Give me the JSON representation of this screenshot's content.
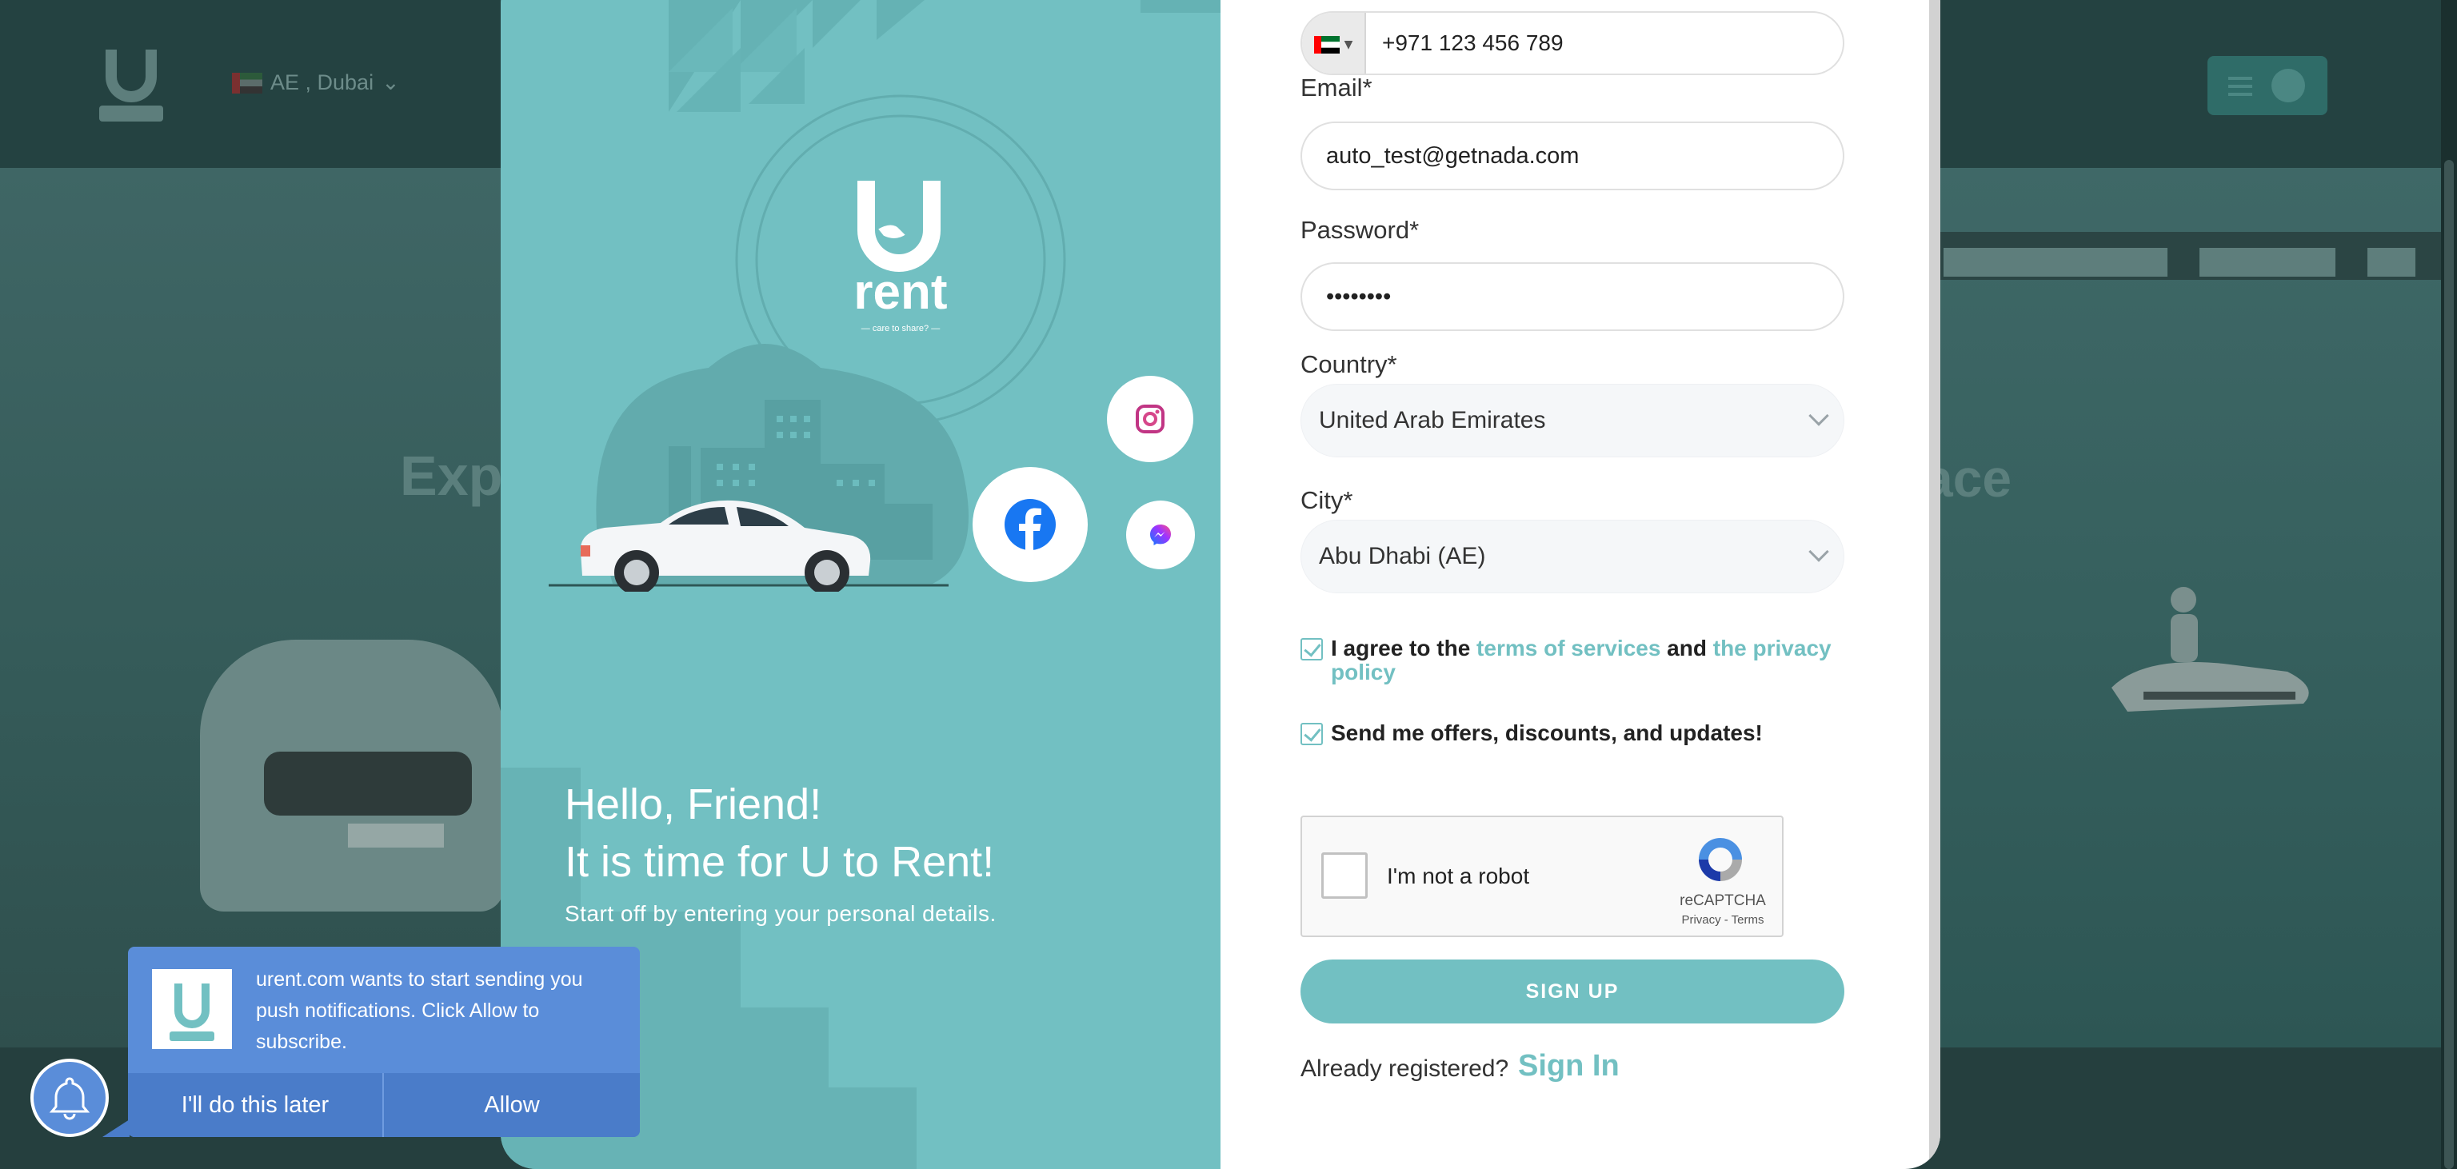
{
  "background": {
    "location": "AE , Dubai",
    "hero_title_left": "Exp",
    "hero_title_right": "ace"
  },
  "hero": {
    "greeting_line1": "Hello, Friend!",
    "greeting_line2": "It is time for U to Rent!",
    "subtitle": "Start off by entering your personal details.",
    "logo_text": "rent",
    "logo_tagline": "— care to share? —"
  },
  "form": {
    "phone": {
      "value": "+971 123 456 789"
    },
    "email": {
      "label": "Email*",
      "value": "auto_test@getnada.com"
    },
    "password": {
      "label": "Password*",
      "value": "password"
    },
    "country": {
      "label": "Country*",
      "selected": "United Arab Emirates"
    },
    "city": {
      "label": "City*",
      "selected": "Abu Dhabi (AE)"
    },
    "agree": {
      "checked": true,
      "prefix": "I agree to the ",
      "terms_link": "terms of services",
      "middle": " and ",
      "privacy_link": "the privacy policy"
    },
    "offers": {
      "checked": true,
      "label": "Send me offers, discounts, and updates!"
    },
    "captcha": {
      "label": "I'm not a robot",
      "brand": "reCAPTCHA",
      "links": "Privacy - Terms"
    },
    "submit_label": "SIGN UP",
    "already_registered": "Already registered?",
    "sign_in_link": "Sign In"
  },
  "push_prompt": {
    "message": "urent.com wants to start sending you push notifications. Click Allow to subscribe.",
    "later_label": "I'll do this later",
    "allow_label": "Allow"
  },
  "colors": {
    "brand_teal": "#72c0c2",
    "push_blue": "#5a8dd9",
    "overlay": "#1f3a3a"
  },
  "icons": [
    "instagram-icon",
    "facebook-icon",
    "messenger-icon",
    "bell-icon",
    "uae-flag-icon",
    "chevron-down-icon",
    "recaptcha-icon"
  ]
}
